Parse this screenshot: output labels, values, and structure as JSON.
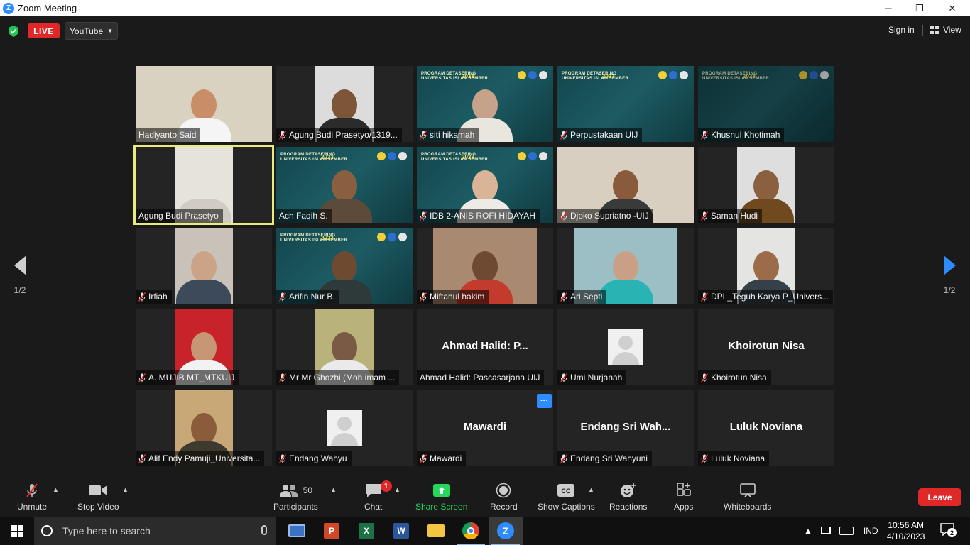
{
  "window": {
    "title": "Zoom Meeting",
    "minimize": "─",
    "restore": "❐",
    "close": "✕"
  },
  "topbar": {
    "live_label": "LIVE",
    "stream_target": "YouTube",
    "signin_label": "Sign in",
    "view_label": "View"
  },
  "pager": {
    "left_page": "1/2",
    "right_page": "1/2"
  },
  "tiles": [
    {
      "name": "Hadiyanto Said",
      "muted": false,
      "type": "video",
      "bg": "#d9d2c0",
      "skin": "#c98d68",
      "shirt": "#f5f5f5",
      "wide": true
    },
    {
      "name": "Agung Budi Prasetyo/1319...",
      "muted": true,
      "type": "video",
      "bg": "#dcdcdc",
      "skin": "#7d5538",
      "shirt": "#2b2b2b",
      "wide": false
    },
    {
      "name": "siti hikamah",
      "muted": true,
      "type": "banner",
      "skin": "#c7a28a",
      "shirt": "#e9e6de"
    },
    {
      "name": "Perpustakaan UIJ",
      "muted": true,
      "type": "banner-empty"
    },
    {
      "name": "Khusnul Khotimah",
      "muted": true,
      "type": "banner-empty-dark"
    },
    {
      "name": "Agung Budi Prasetyo",
      "muted": false,
      "active": true,
      "type": "video",
      "bg": "#e6e3dc",
      "skin": "#e6e3dc",
      "shirt": "#d0ccc4",
      "wide": false
    },
    {
      "name": "Ach Faqih S.",
      "muted": false,
      "type": "banner",
      "skin": "#8a5f40",
      "shirt": "#5c4a3a"
    },
    {
      "name": "IDB 2-ANIS ROFI HIDAYAH",
      "muted": true,
      "type": "banner",
      "skin": "#d9b497",
      "shirt": "#ecebe6"
    },
    {
      "name": "Djoko Supriatno -UIJ",
      "muted": true,
      "type": "video",
      "bg": "#d8cfc0",
      "skin": "#8a5a3c",
      "shirt": "#3a3a3a",
      "wide": true
    },
    {
      "name": "Saman Hudi",
      "muted": true,
      "type": "video",
      "bg": "#dedede",
      "skin": "#8a603f",
      "shirt": "#6e4a1e",
      "wide": false
    },
    {
      "name": "Irfiah",
      "muted": true,
      "type": "video",
      "bg": "#c9c2b8",
      "skin": "#cba487",
      "shirt": "#3c4a5a",
      "wide": false
    },
    {
      "name": "Arifin Nur B.",
      "muted": true,
      "type": "banner",
      "skin": "#6e4a30",
      "shirt": "#2e3a3a"
    },
    {
      "name": "Miftahul hakim",
      "muted": true,
      "type": "video",
      "bg": "#a98a70",
      "skin": "#6e4a32",
      "shirt": "#c23b2c",
      "wide": false,
      "wider": true
    },
    {
      "name": "Ari Septi",
      "muted": true,
      "type": "video",
      "bg": "#9bbfc4",
      "skin": "#c9a085",
      "shirt": "#2ab3b3",
      "wide": false,
      "wider": true
    },
    {
      "name": "DPL_Teguh Karya P_Univers...",
      "muted": true,
      "type": "video",
      "bg": "#e4e4e2",
      "skin": "#9c6c4a",
      "shirt": "#35404a",
      "wide": false
    },
    {
      "name": "A. MUJIB MT_MTKUIJ",
      "muted": true,
      "type": "video",
      "bg": "#c8222b",
      "skin": "#c69675",
      "shirt": "#f2f2f2",
      "wide": false
    },
    {
      "name": "Mr Mr Ghozhi (Moh imam ...",
      "muted": true,
      "type": "video",
      "bg": "#b9b27a",
      "skin": "#7a5a44",
      "shirt": "#eaeaea",
      "wide": false
    },
    {
      "name": "Ahmad Halid: Pascasarjana UIJ",
      "muted": false,
      "type": "text",
      "big": "Ahmad Halid: P..."
    },
    {
      "name": "Umi Nurjanah",
      "muted": true,
      "type": "avatar"
    },
    {
      "name": "Khoirotun Nisa",
      "muted": true,
      "type": "text",
      "big": "Khoirotun Nisa"
    },
    {
      "name": "Alif Endy Pamuji_Universita...",
      "muted": true,
      "type": "video",
      "bg": "#c9a878",
      "skin": "#8a5c3c",
      "shirt": "#3e3a30",
      "wide": false
    },
    {
      "name": "Endang Wahyu",
      "muted": true,
      "type": "avatar"
    },
    {
      "name": "Mawardi",
      "muted": true,
      "type": "text",
      "big": "Mawardi",
      "more": true
    },
    {
      "name": "Endang Sri Wahyuni",
      "muted": true,
      "type": "text",
      "big": "Endang Sri Wah..."
    },
    {
      "name": "Luluk Noviana",
      "muted": true,
      "type": "text",
      "big": "Luluk Noviana"
    }
  ],
  "banner": {
    "title_line1": "PROGRAM DETASERING",
    "title_line2": "UNIVERSITAS ISLAM JEMBER",
    "year": "2023"
  },
  "toolbar": {
    "unmute": "Unmute",
    "stop_video": "Stop Video",
    "participants": "Participants",
    "participants_count": "50",
    "chat": "Chat",
    "chat_badge": "1",
    "share_screen": "Share Screen",
    "record": "Record",
    "show_captions": "Show Captions",
    "reactions": "Reactions",
    "apps": "Apps",
    "whiteboards": "Whiteboards",
    "leave": "Leave"
  },
  "taskbar": {
    "search_placeholder": "Type here to search",
    "language": "IND",
    "time": "10:56 AM",
    "date": "4/10/2023",
    "notifications": "2"
  },
  "colors": {
    "accent": "#2d8cff",
    "danger": "#e02828",
    "share_green": "#23d959",
    "active_speaker": "#e9ec7a"
  }
}
